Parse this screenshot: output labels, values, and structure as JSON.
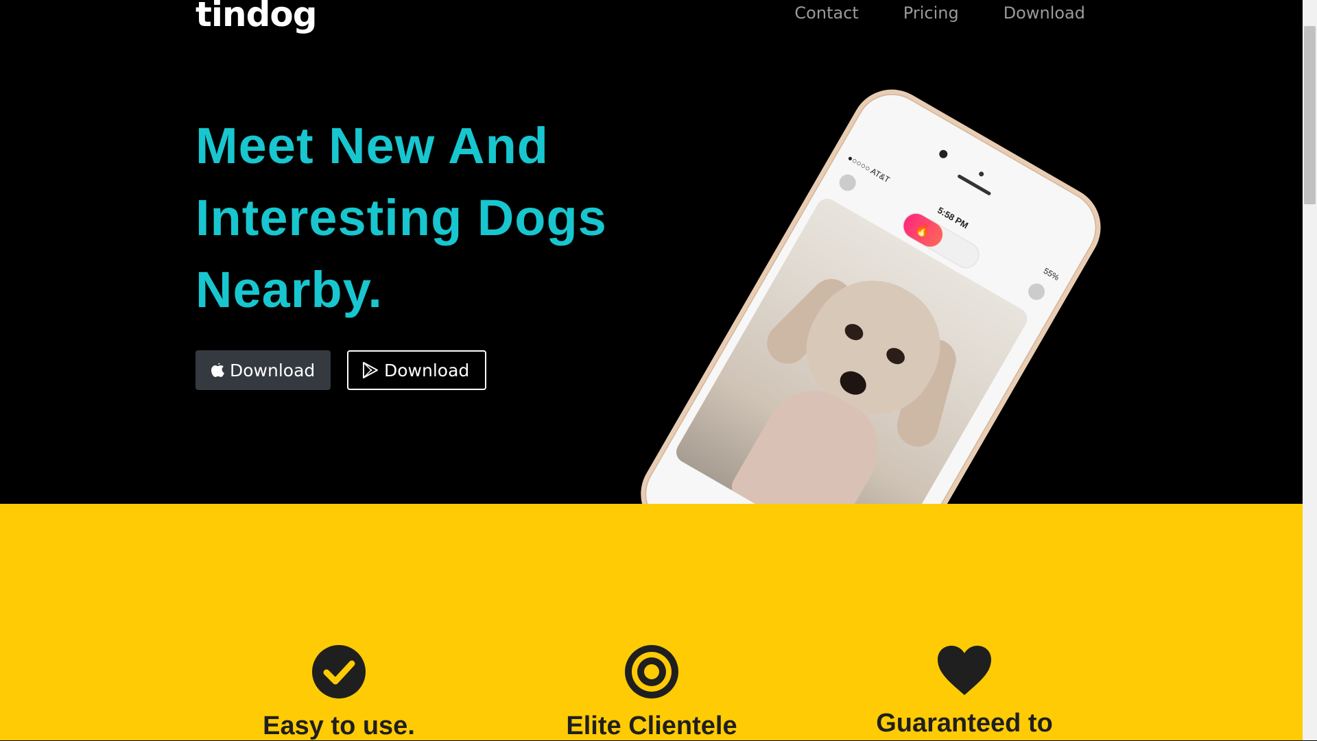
{
  "brand": {
    "name": "tindog"
  },
  "nav": {
    "items": [
      "Contact",
      "Pricing",
      "Download"
    ]
  },
  "hero": {
    "headline": "Meet New And Interesting Dogs Nearby.",
    "buttons": {
      "apple": "Download",
      "play": "Download"
    }
  },
  "phone": {
    "carrier": "●○○○○ AT&T",
    "time": "5:58 PM",
    "battery": "55%"
  },
  "features": [
    {
      "icon": "check-circle-icon",
      "title": "Easy to use."
    },
    {
      "icon": "bullseye-icon",
      "title": "Elite Clientele"
    },
    {
      "icon": "heart-icon",
      "title": "Guaranteed to"
    }
  ],
  "colors": {
    "hero_bg": "#000000",
    "headline": "#18c6cf",
    "features_bg": "#ffcb05",
    "feature_text": "#1f1f1f"
  }
}
